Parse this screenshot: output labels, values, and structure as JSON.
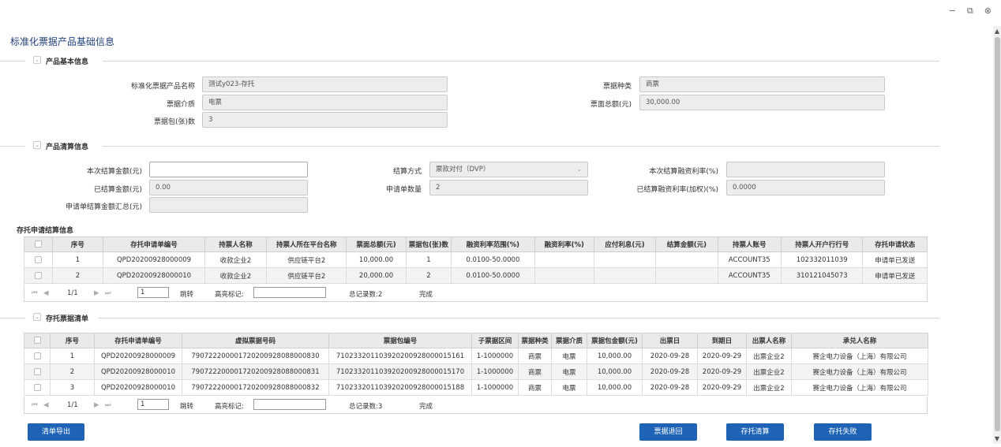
{
  "window": {
    "minimize": "−",
    "restore": "⧉",
    "close": "⊗"
  },
  "page_title": "标准化票据产品基础信息",
  "section_basic": {
    "title": "产品基本信息",
    "name_label": "标准化票据产品名称",
    "name_value": "测试y023-存托",
    "type_label": "票据种类",
    "type_value": "商票",
    "medium_label": "票据介质",
    "medium_value": "电票",
    "total_label": "票面总额(元)",
    "total_value": "30,000.00",
    "count_label": "票据包(张)数",
    "count_value": "3"
  },
  "section_settle": {
    "title": "产品清算信息",
    "amount_label": "本次结算金额(元)",
    "amount_value": "",
    "method_label": "结算方式",
    "method_value": "票款对付（DVP）",
    "rate_label": "本次结算融资利率(%)",
    "rate_value": "",
    "settled_label": "已结算金额(元)",
    "settled_value": "0.00",
    "apply_count_label": "申请单数量",
    "apply_count_value": "2",
    "settled_rate_label": "已结算融资利率(加权)(%)",
    "settled_rate_value": "0.0000",
    "summary_label": "申请单结算金额汇总(元)",
    "summary_value": ""
  },
  "grid1": {
    "title": "存托申请结算信息",
    "columns": [
      "序号",
      "存托申请单编号",
      "持票人名称",
      "持票人所在平台名称",
      "票面总额(元)",
      "票据包(张)数",
      "融资利率范围(%)",
      "融资利率(%)",
      "应付利息(元)",
      "结算金额(元)",
      "持票人账号",
      "持票人开户行行号",
      "存托申请状态"
    ],
    "rows": [
      [
        "1",
        "QPD20200928000009",
        "收款企业2",
        "供应链平台2",
        "10,000.00",
        "1",
        "0.0100-50.0000",
        "",
        "",
        "",
        "ACCOUNT35",
        "102332011039",
        "申请单已发送"
      ],
      [
        "2",
        "QPD20200928000010",
        "收款企业2",
        "供应链平台2",
        "20,000.00",
        "2",
        "0.0100-50.0000",
        "",
        "",
        "",
        "ACCOUNT35",
        "310121045073",
        "申请单已发送"
      ]
    ],
    "pager": {
      "first": "⏮",
      "prev": "◀",
      "page": "1/1",
      "next": "▶",
      "last": "⏭",
      "goto_value": "1",
      "jump": "跳转",
      "highlight": "高亮标记:",
      "total": "总记录数:2",
      "status": "完成"
    }
  },
  "section_list": {
    "title": "存托票据清单"
  },
  "grid2": {
    "columns": [
      "序号",
      "存托申请单编号",
      "虚拟票据号码",
      "票据包编号",
      "子票据区间",
      "票据种类",
      "票据介质",
      "票据包金额(元)",
      "出票日",
      "到期日",
      "出票人名称",
      "承兑人名称"
    ],
    "rows": [
      [
        "1",
        "QPD20200928000009",
        "790722200001720200928088000830",
        "710233201103920200928000015161",
        "1-1000000",
        "商票",
        "电票",
        "10,000.00",
        "2020-09-28",
        "2020-09-29",
        "出票企业2",
        "赛企电力设备（上海）有限公司"
      ],
      [
        "2",
        "QPD20200928000010",
        "790722200001720200928088000831",
        "710233201103920200928000015170",
        "1-1000000",
        "商票",
        "电票",
        "10,000.00",
        "2020-09-28",
        "2020-09-29",
        "出票企业2",
        "赛企电力设备（上海）有限公司"
      ],
      [
        "3",
        "QPD20200928000010",
        "790722200001720200928088000832",
        "710233201103920200928000015188",
        "1-1000000",
        "商票",
        "电票",
        "10,000.00",
        "2020-09-28",
        "2020-09-29",
        "出票企业2",
        "赛企电力设备（上海）有限公司"
      ]
    ],
    "pager": {
      "first": "⏮",
      "prev": "◀",
      "page": "1/1",
      "next": "▶",
      "last": "⏭",
      "goto_value": "1",
      "jump": "跳转",
      "highlight": "高亮标记:",
      "total": "总记录数:3",
      "status": "完成"
    }
  },
  "buttons": {
    "export": "清单导出",
    "return": "票据退回",
    "clear": "存托清算",
    "fail": "存托失败"
  },
  "colors": {
    "primary_button": "#1e63b6",
    "title": "#1f3f7a"
  }
}
